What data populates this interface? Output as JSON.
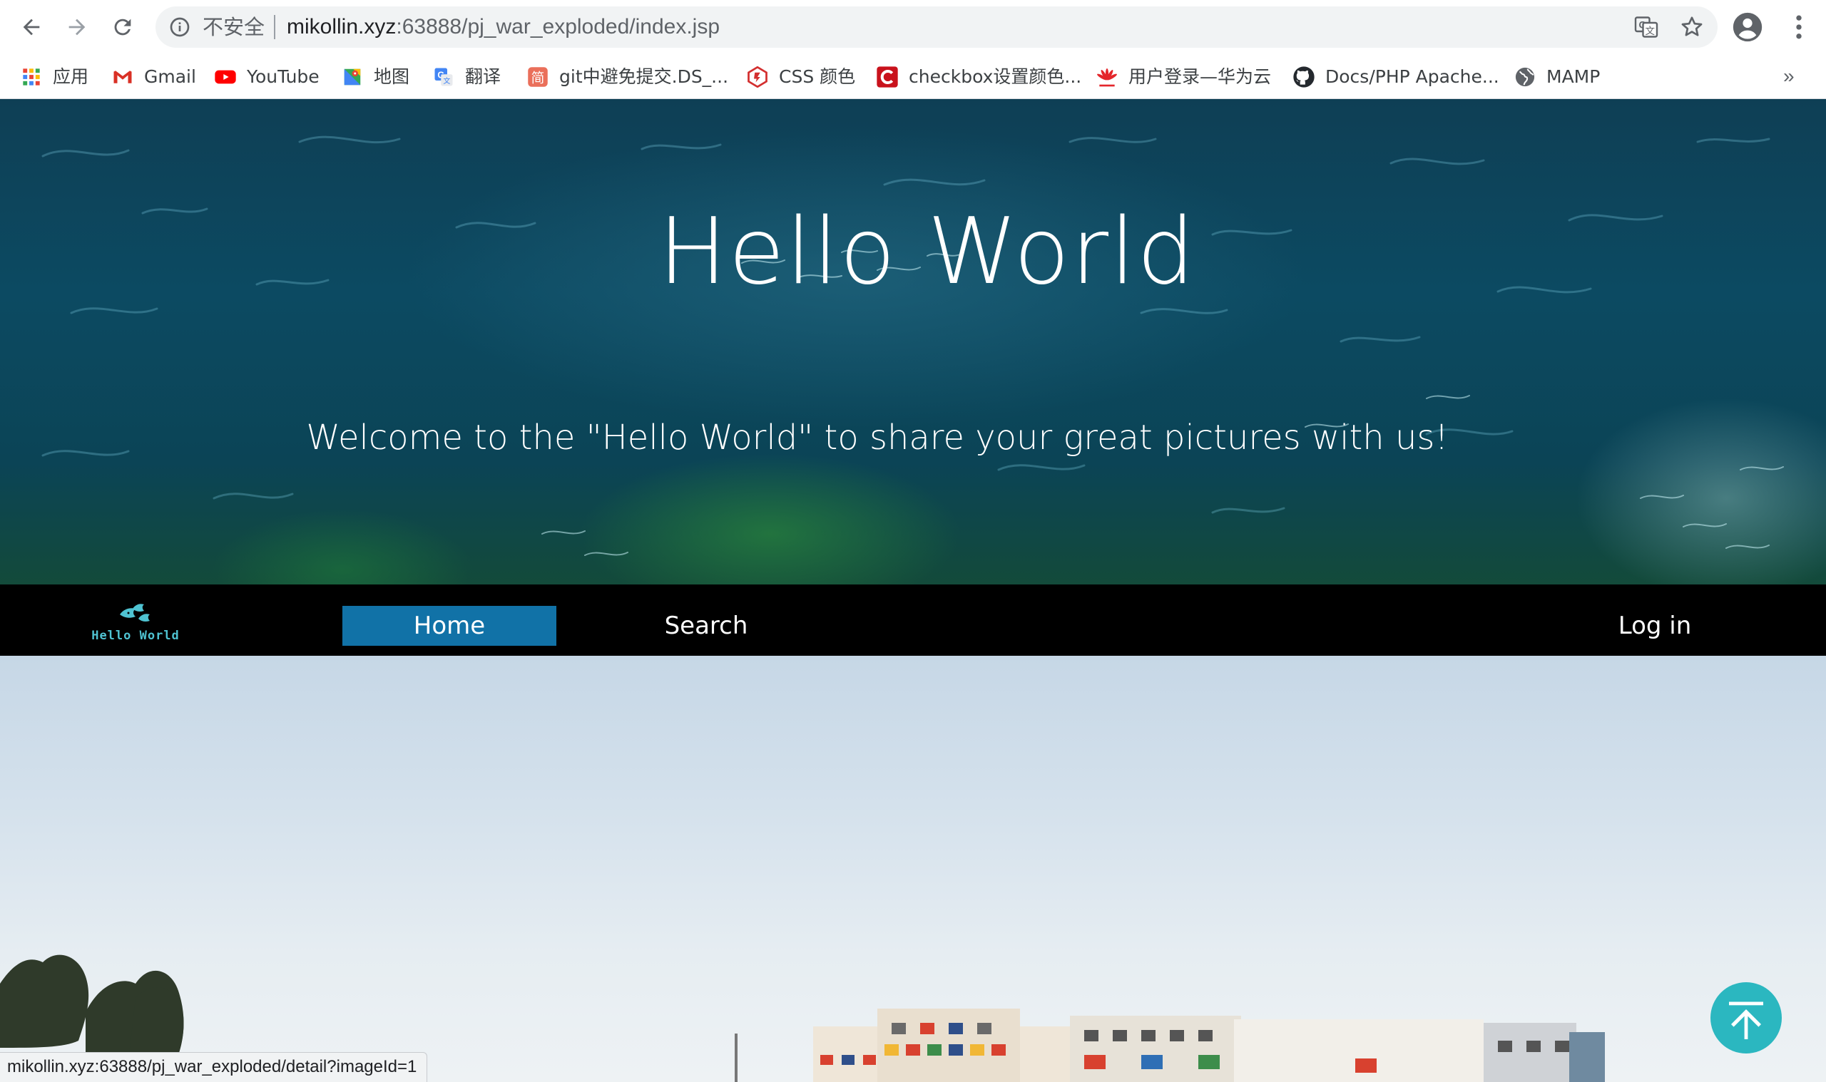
{
  "browser": {
    "security_label": "不安全",
    "url_host": "mikollin.xyz",
    "url_rest": ":63888/pj_war_exploded/index.jsp",
    "status_url": "mikollin.xyz:63888/pj_war_exploded/detail?imageId=1"
  },
  "bookmarks": {
    "items": [
      {
        "label": "应用",
        "icon": "apps-grid-icon"
      },
      {
        "label": "Gmail",
        "icon": "gmail-icon"
      },
      {
        "label": "YouTube",
        "icon": "youtube-icon"
      },
      {
        "label": "地图",
        "icon": "maps-icon"
      },
      {
        "label": "翻译",
        "icon": "translate-icon"
      },
      {
        "label": "git中避免提交.DS_...",
        "icon": "jianshu-icon"
      },
      {
        "label": "CSS 颜色",
        "icon": "runoob-icon"
      },
      {
        "label": "checkbox设置颜色...",
        "icon": "csdn-icon"
      },
      {
        "label": "用户登录—华为云",
        "icon": "huawei-icon"
      },
      {
        "label": "Docs/PHP Apache...",
        "icon": "github-icon"
      },
      {
        "label": "MAMP",
        "icon": "globe-icon"
      }
    ],
    "more": "»"
  },
  "hero": {
    "title": "Hello World",
    "subtitle": "Welcome to the \"Hello World\" to share your great pictures with us!"
  },
  "nav": {
    "logo_text": "Hello World",
    "home": "Home",
    "search": "Search",
    "login": "Log in"
  },
  "colors": {
    "nav_active": "#1172a7",
    "nav_bg": "#000000",
    "to_top": "#2bb7c0"
  }
}
